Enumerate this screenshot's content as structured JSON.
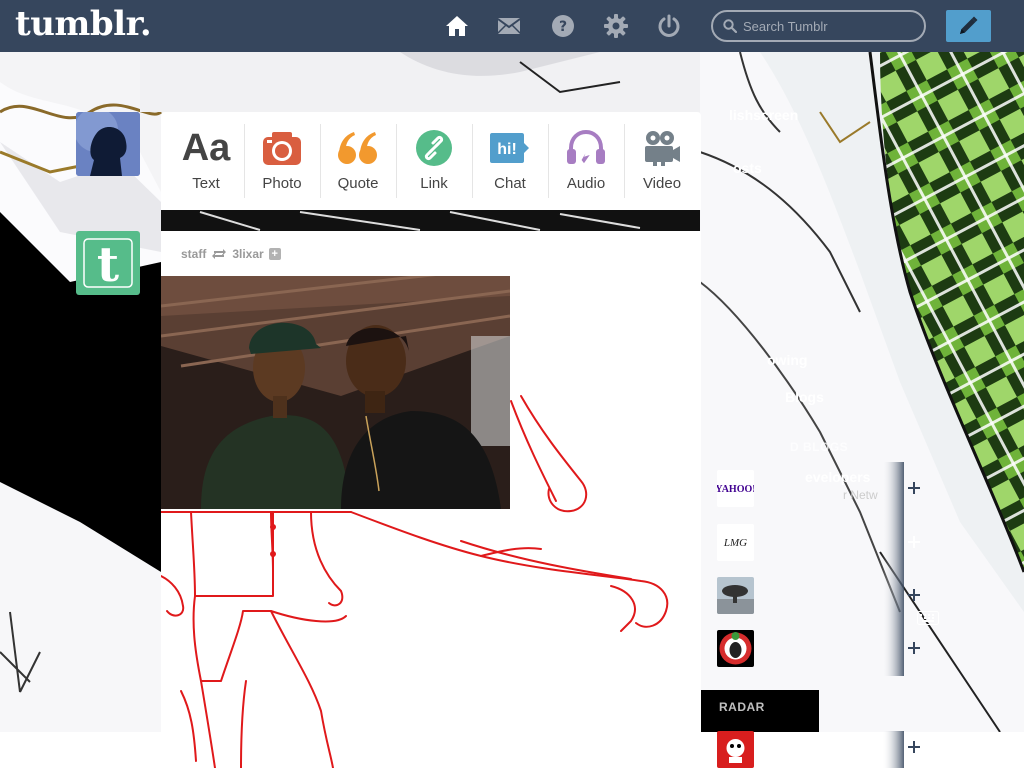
{
  "app": {
    "logo": "tumblr.",
    "search": {
      "placeholder": "Search Tumblr"
    }
  },
  "nav": {
    "icons": [
      "home-icon",
      "mail-icon",
      "help-icon",
      "settings-icon",
      "power-icon"
    ]
  },
  "post_types": [
    {
      "label": "Text",
      "glyph": "Aa",
      "color": "#444444"
    },
    {
      "label": "Photo",
      "color": "#d95e40"
    },
    {
      "label": "Quote",
      "color": "#f2992e"
    },
    {
      "label": "Link",
      "color": "#56bc8a"
    },
    {
      "label": "Chat",
      "color": "#529ecc"
    },
    {
      "label": "Audio",
      "color": "#a77dc2"
    },
    {
      "label": "Video",
      "color": "#748089"
    }
  ],
  "post": {
    "author": "staff",
    "reblogged_from": "3lixar",
    "follow_label": "+"
  },
  "sidebar": {
    "partial_items": [
      {
        "text": "lishscreen"
      },
      {
        "text": "osts"
      },
      {
        "text": "owing"
      },
      {
        "text": "Blogs"
      }
    ],
    "recommended_heading": "D BLOGS",
    "recommended": [
      {
        "thumb_text": "YAHOO!",
        "name": "evelopers",
        "subtitle": "r Netw"
      },
      {
        "thumb_text": "LMG",
        "name": "",
        "subtitle": ""
      },
      {
        "thumb_text": "",
        "name": "",
        "subtitle": ""
      },
      {
        "thumb_text": "",
        "name": "",
        "subtitle": ""
      }
    ],
    "radar_heading": "RADAR"
  },
  "colors": {
    "topbar": "#36465d",
    "search_border": "#a3aab5",
    "compose": "#529ecc",
    "tumblr_green": "#56bc8a",
    "sketch_red": "#e0191b"
  }
}
